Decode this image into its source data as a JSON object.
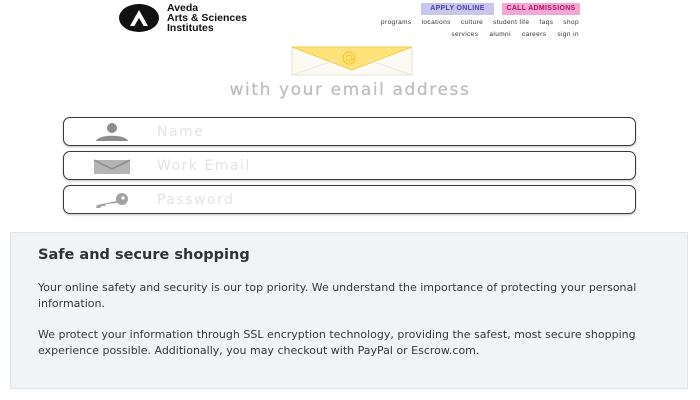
{
  "header": {
    "logo": {
      "icon": "aveda-a-icon",
      "line1": "Aveda",
      "line2": "Arts & Sciences",
      "line3": "Institutes"
    },
    "apply_label": "APPLY ONLINE",
    "call_label": "CALL ADMISSIONS",
    "apply_color": "#c9c6ee",
    "call_color": "#f5a8d6",
    "nav_primary": [
      "programs",
      "locations",
      "culture",
      "student life",
      "faqs",
      "shop"
    ],
    "nav_secondary": [
      "services",
      "alumni",
      "careers",
      "sign in"
    ]
  },
  "signup": {
    "envelope_icon": "envelope-icon",
    "heading": "with your email address",
    "fields": [
      {
        "icon": "user-icon",
        "placeholder": "Name",
        "value": ""
      },
      {
        "icon": "mail-icon",
        "placeholder": "Work Email",
        "value": ""
      },
      {
        "icon": "key-icon",
        "placeholder": "Password",
        "value": ""
      }
    ]
  },
  "secure": {
    "title": "Safe and secure shopping",
    "paragraph1": "Your online safety and security is our top priority. We understand the importance of protecting your personal information.",
    "paragraph2": "We protect your information through SSL encryption technology, providing the safest, most secure shopping experience possible. Additionally, you may checkout with PayPal or Escrow.com."
  }
}
